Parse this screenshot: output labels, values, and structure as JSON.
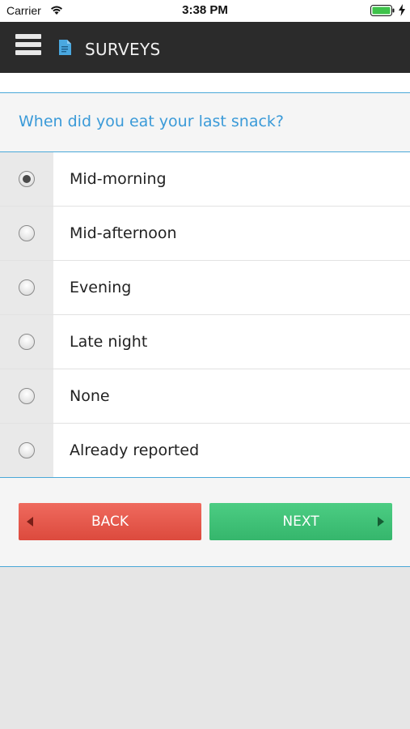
{
  "status_bar": {
    "carrier": "Carrier",
    "time": "3:38 PM",
    "icons": [
      "wifi-icon",
      "battery-icon",
      "charging-bolt-icon"
    ]
  },
  "nav": {
    "title": "SURVEYS",
    "menu_icon": "hamburger-icon",
    "title_icon": "document-icon"
  },
  "survey": {
    "question": "When did you eat your last snack?",
    "options": [
      {
        "label": "Mid-morning",
        "selected": true
      },
      {
        "label": "Mid-afternoon",
        "selected": false
      },
      {
        "label": "Evening",
        "selected": false
      },
      {
        "label": "Late night",
        "selected": false
      },
      {
        "label": "None",
        "selected": false
      },
      {
        "label": "Already reported",
        "selected": false
      }
    ]
  },
  "buttons": {
    "back_label": "BACK",
    "next_label": "NEXT"
  },
  "colors": {
    "accent": "#3a9ad8",
    "nav_background": "#2b2b2b",
    "back_button": "#e5574b",
    "next_button": "#40c277"
  }
}
